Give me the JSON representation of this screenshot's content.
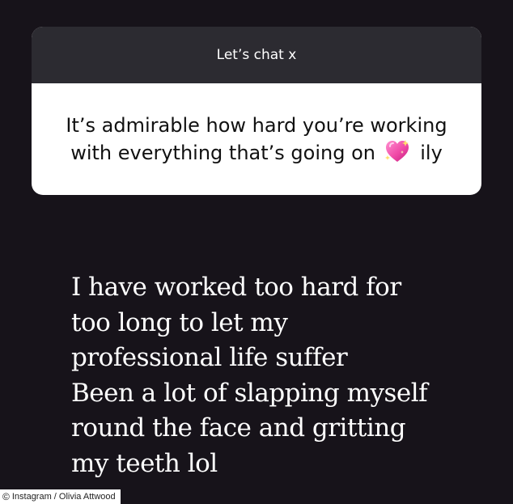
{
  "question_box": {
    "title": "Let’s chat x",
    "question_text": "It’s admirable how hard you’re working with everything that’s going on",
    "question_suffix": "ily",
    "emoji_icon": "sparkling-heart-icon"
  },
  "answer": {
    "lines": [
      "I have worked too hard for",
      "too long to let my",
      "professional life suffer",
      "Been a lot of slapping myself",
      "round the face and gritting",
      "my teeth lol"
    ]
  },
  "credit": {
    "icon": "copyright-icon",
    "icon_glyph": "©",
    "text": "Instagram / Olivia Attwood"
  },
  "colors": {
    "background": "#17131a",
    "header": "#2c2b31",
    "card": "#ffffff"
  }
}
